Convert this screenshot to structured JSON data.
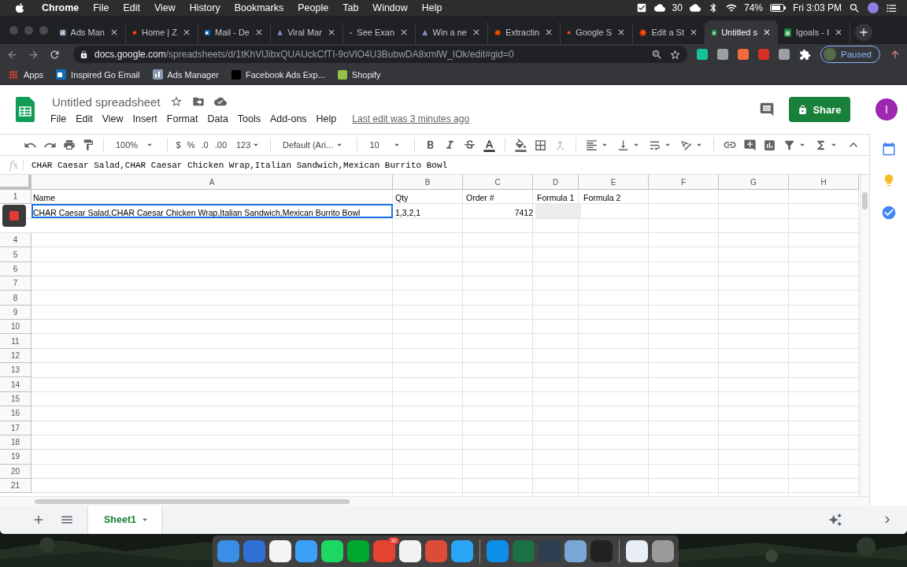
{
  "menubar": {
    "app": "Chrome",
    "menus": [
      "File",
      "Edit",
      "View",
      "History",
      "Bookmarks",
      "People",
      "Tab",
      "Window",
      "Help"
    ],
    "badge_count": "30",
    "battery": "74%",
    "clock": "Fri 3:03 PM"
  },
  "browser": {
    "tabs": [
      {
        "title": "Ads Man",
        "kind": "ads",
        "selected": false
      },
      {
        "title": "Home | Z",
        "kind": "zapier",
        "selected": false
      },
      {
        "title": "Mail - De",
        "kind": "mail",
        "selected": false
      },
      {
        "title": "Viral Mar",
        "kind": "viral",
        "selected": false
      },
      {
        "title": "See Exan",
        "kind": "viral",
        "selected": false
      },
      {
        "title": "Win a ne",
        "kind": "viral",
        "selected": false
      },
      {
        "title": "Extractin",
        "kind": "zapier",
        "selected": false
      },
      {
        "title": "Google S",
        "kind": "zapier",
        "selected": false
      },
      {
        "title": "Edit a St",
        "kind": "zapier",
        "selected": false
      },
      {
        "title": "Untitled s",
        "kind": "sheets",
        "selected": true
      },
      {
        "title": "Igoals - I",
        "kind": "sheets",
        "selected": false
      }
    ],
    "url_host": "docs.google.com",
    "url_path": "/spreadsheets/d/1tKhVlJibxQUAUckCfTI-9oVlO4U3BubwDA8xmlW_IOk/edit#gid=0",
    "profile": "Paused",
    "bookmarks": [
      {
        "label": "Apps",
        "kind": "apps"
      },
      {
        "label": "Inspired Go Email",
        "kind": "mail"
      },
      {
        "label": "Ads Manager",
        "kind": "ads"
      },
      {
        "label": "Facebook Ads Exp...",
        "kind": "dark"
      },
      {
        "label": "Shopify",
        "kind": "shop"
      }
    ]
  },
  "sheets": {
    "title": "Untitled spreadsheet",
    "menus": [
      "File",
      "Edit",
      "View",
      "Insert",
      "Format",
      "Data",
      "Tools",
      "Add-ons",
      "Help"
    ],
    "last_edit": "Last edit was 3 minutes ago",
    "share": "Share",
    "avatar": "I",
    "toolbar": {
      "zoom": "100%",
      "currency": "$",
      "percent": "%",
      "decimal_less": ".0",
      "decimal_more": ".00",
      "number_format": "123",
      "font": "Default (Ari...",
      "font_size": "10"
    },
    "formula_label": "fx",
    "formula": "CHAR Caesar Salad,CHAR Caesar Chicken Wrap,Italian Sandwich,Mexican Burrito Bowl",
    "columns": [
      "A",
      "B",
      "C",
      "D",
      "E",
      "F",
      "G",
      "H"
    ],
    "rows": [
      {
        "number": "1",
        "cells": [
          {
            "text": "Name",
            "kind": "text",
            "selected": false,
            "shaded": false
          },
          {
            "text": "Qty",
            "kind": "text",
            "selected": false,
            "shaded": false
          },
          {
            "text": "Order #",
            "kind": "text",
            "selected": false,
            "shaded": false
          },
          {
            "text": "Formula 1",
            "kind": "text",
            "selected": false,
            "shaded": false
          },
          {
            "text": "Formula 2",
            "kind": "text",
            "selected": false,
            "shaded": false
          }
        ]
      },
      {
        "cells": [
          {
            "text": "CHAR Caesar Salad,CHAR Caesar Chicken Wrap,Italian Sandwich,Mexican Burrito Bowl",
            "kind": "text",
            "selected": true,
            "shaded": false
          },
          {
            "text": "1,3,2,1",
            "kind": "text",
            "selected": false,
            "shaded": false
          },
          {
            "text": "7412",
            "kind": "number",
            "selected": false,
            "shaded": false
          },
          {
            "kind": "text",
            "selected": false,
            "shaded": true
          }
        ]
      },
      {
        "cells": []
      },
      {
        "number": "4",
        "cells": []
      },
      {
        "number": "5",
        "cells": []
      },
      {
        "number": "6",
        "cells": []
      },
      {
        "number": "7",
        "cells": []
      },
      {
        "number": "8",
        "cells": []
      },
      {
        "number": "9",
        "cells": []
      },
      {
        "number": "10",
        "cells": []
      },
      {
        "number": "11",
        "cells": []
      },
      {
        "number": "12",
        "cells": []
      },
      {
        "number": "13",
        "cells": []
      },
      {
        "number": "14",
        "cells": []
      },
      {
        "number": "15",
        "cells": []
      },
      {
        "number": "16",
        "cells": []
      },
      {
        "number": "17",
        "cells": []
      },
      {
        "number": "18",
        "cells": []
      },
      {
        "number": "19",
        "cells": []
      },
      {
        "number": "20",
        "cells": []
      },
      {
        "number": "21",
        "cells": []
      }
    ],
    "sheet_tabs": [
      {
        "label": "Sheet1",
        "selected": true
      }
    ]
  },
  "dock": [
    {
      "kind": "app",
      "color": "#3b8ee8"
    },
    {
      "kind": "app",
      "color": "#2f6fd6"
    },
    {
      "kind": "app",
      "color": "#f4f4f4"
    },
    {
      "kind": "app",
      "color": "#3aa0f5"
    },
    {
      "kind": "app",
      "color": "#1ed760"
    },
    {
      "kind": "app",
      "color": "#00a82d"
    },
    {
      "kind": "app",
      "color": "#e44332",
      "badge": "30"
    },
    {
      "kind": "app",
      "color": "#f2f2f2"
    },
    {
      "kind": "app",
      "color": "#dd4b39"
    },
    {
      "kind": "app",
      "color": "#2aa4f4"
    },
    {
      "kind": "separator"
    },
    {
      "kind": "app",
      "color": "#0e8ee9"
    },
    {
      "kind": "app",
      "color": "#1d7044"
    },
    {
      "kind": "app",
      "color": "#2c3e50"
    },
    {
      "kind": "app",
      "color": "#7aa6d6"
    },
    {
      "kind": "app",
      "color": "#222222"
    },
    {
      "kind": "separator"
    },
    {
      "kind": "app",
      "color": "#e8eef5"
    },
    {
      "kind": "app",
      "color": "#9a9a9a"
    }
  ]
}
